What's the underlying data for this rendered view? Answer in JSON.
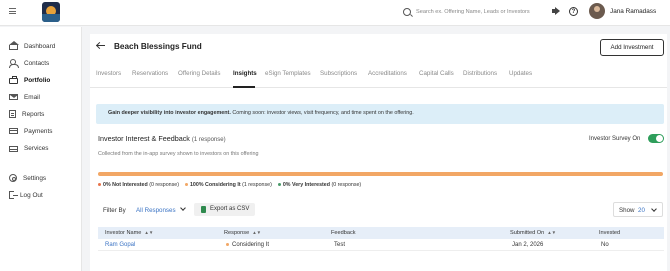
{
  "topbar": {
    "search_placeholder": "Search ex. Offering Name, Leads or Investors",
    "help_label": "?",
    "user_name": "Jana Ramadass"
  },
  "sidebar": {
    "items": [
      {
        "label": "Dashboard",
        "icon": "home-icon"
      },
      {
        "label": "Contacts",
        "icon": "contacts-icon"
      },
      {
        "label": "Portfolio",
        "icon": "briefcase-icon",
        "active": true
      },
      {
        "label": "Email",
        "icon": "mail-icon"
      },
      {
        "label": "Reports",
        "icon": "reports-icon"
      },
      {
        "label": "Payments",
        "icon": "card-icon"
      },
      {
        "label": "Services",
        "icon": "services-icon"
      },
      {
        "label": "Settings",
        "icon": "gear-icon"
      },
      {
        "label": "Log Out",
        "icon": "logout-icon"
      }
    ]
  },
  "header": {
    "title": "Beach Blessings Fund",
    "add_investment_label": "Add Investment"
  },
  "tabs": [
    {
      "label": "Investors"
    },
    {
      "label": "Reservations"
    },
    {
      "label": "Offering Details"
    },
    {
      "label": "Insights",
      "active": true
    },
    {
      "label": "eSign Templates"
    },
    {
      "label": "Subscriptions"
    },
    {
      "label": "Accreditations"
    },
    {
      "label": "Capital Calls"
    },
    {
      "label": "Distributions"
    },
    {
      "label": "Updates"
    }
  ],
  "banner": {
    "bold_text": "Gain deeper visibility into investor engagement.",
    "text": " Coming soon: investor views, visit frequency, and time spent on the offering."
  },
  "feedback": {
    "title": "Investor Interest & Feedback",
    "count_label": "(1 response)",
    "subtitle": "Collected from the in-app survey shown to investors on this offering",
    "survey_toggle_label": "Investor Survey On",
    "survey_on": true,
    "breakdown": [
      {
        "percent": "0% Not Interested",
        "count": "(0 response)",
        "color": "#e8734a"
      },
      {
        "percent": "100% Considering It",
        "count": "(1 response)",
        "color": "#f2a765"
      },
      {
        "percent": "0% Very Interested",
        "count": "(0 response)",
        "color": "#4a9a6a"
      }
    ],
    "considering_fraction": 1.0
  },
  "filters": {
    "filter_label": "Filter By",
    "filter_value": "All Responses",
    "export_label": "Export as CSV",
    "show_label": "Show",
    "show_value": "20"
  },
  "table": {
    "columns": [
      "Investor Name",
      "Response",
      "Feedback",
      "Submitted On",
      "Invested"
    ],
    "rows": [
      {
        "name": "Ram Gopal",
        "response": "Considering It",
        "feedback": "Test",
        "submitted": "Jan 2, 2026",
        "invested": "No"
      }
    ]
  },
  "colors": {
    "accent": "#3a73c4",
    "toggle_on": "#2e9e5b",
    "banner_bg": "#dceef8",
    "bar": "#f2a765"
  }
}
